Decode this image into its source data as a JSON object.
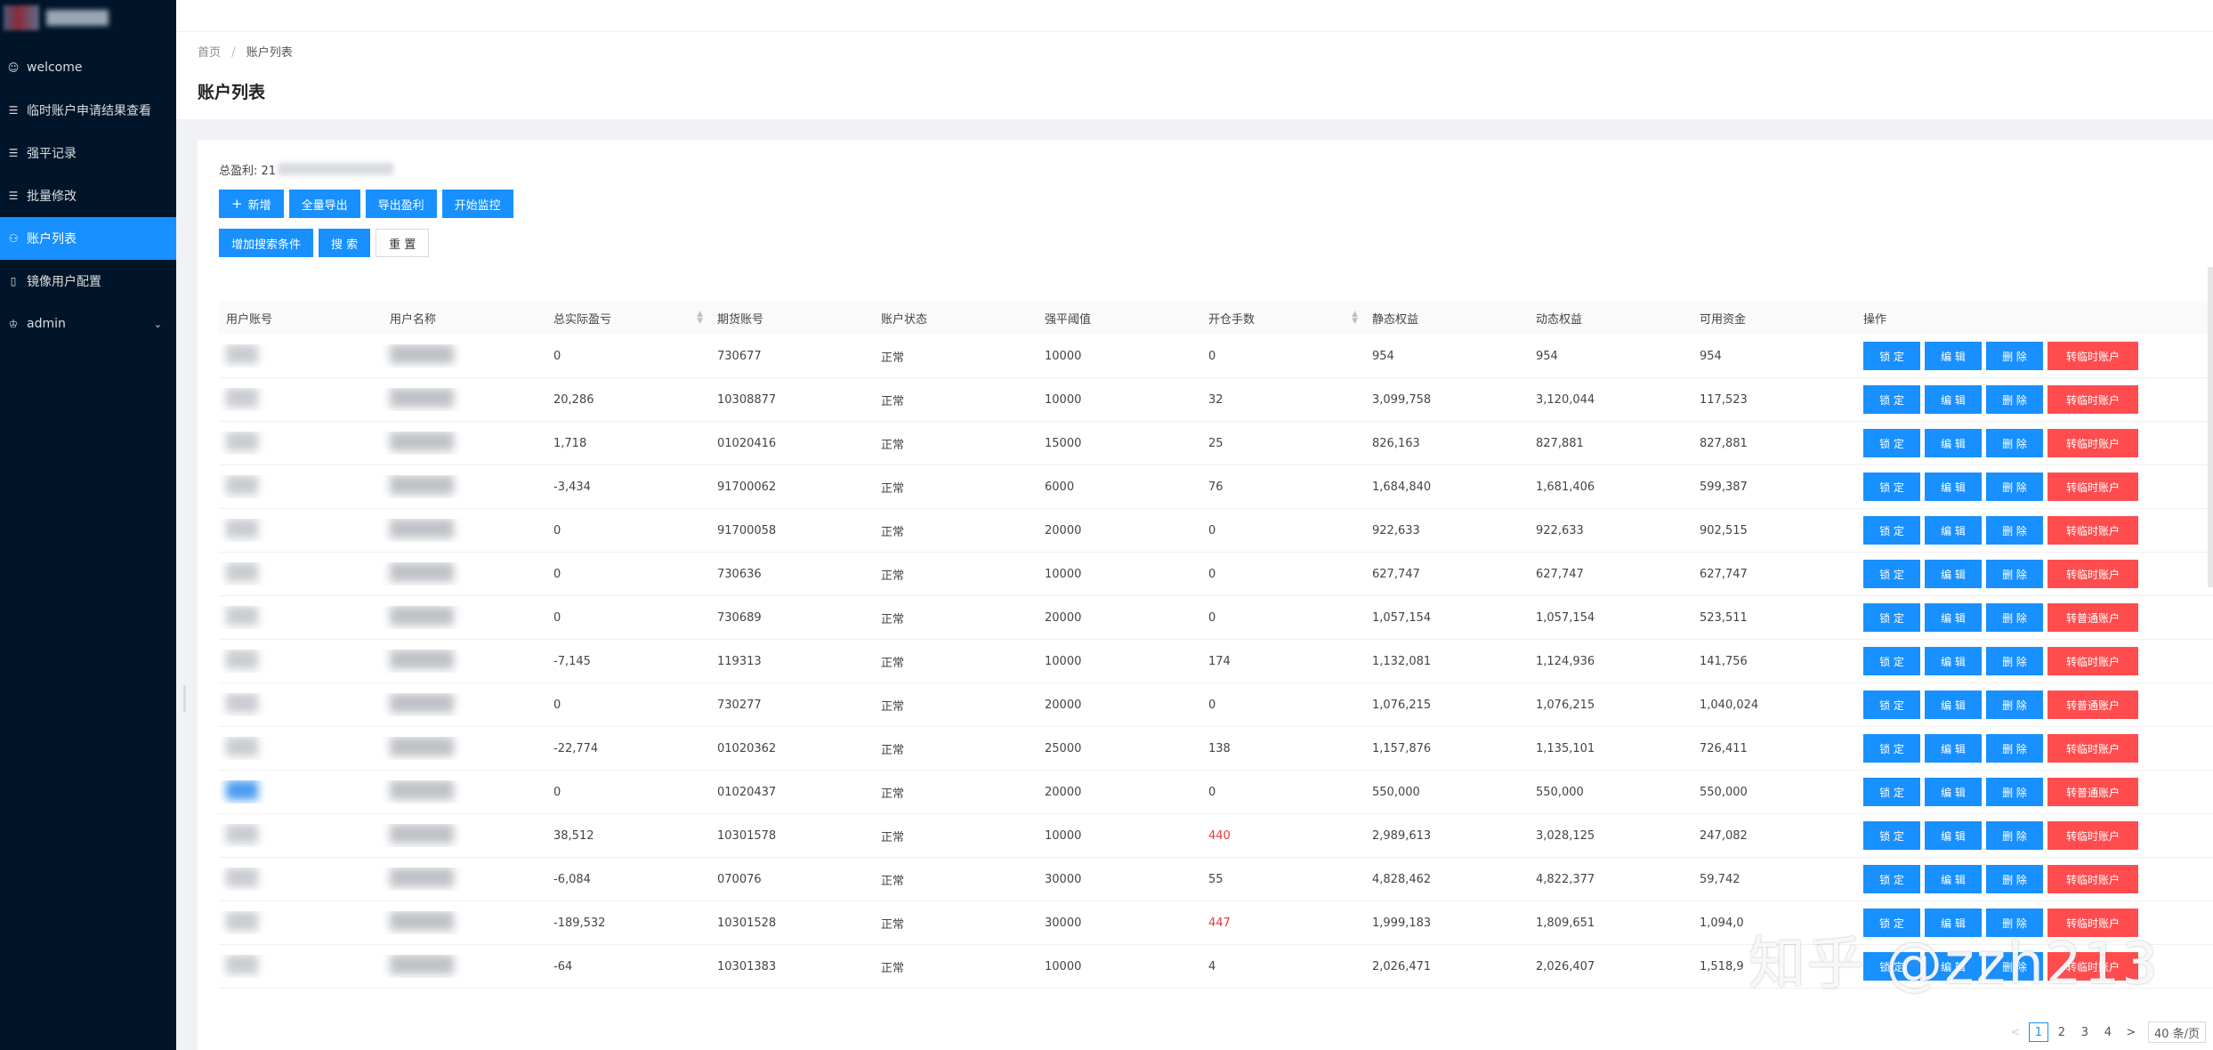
{
  "sidebar": {
    "items": [
      {
        "label": "welcome",
        "icon": "smile-icon"
      },
      {
        "label": "临时账户申请结果查看",
        "icon": "list-icon"
      },
      {
        "label": "强平记录",
        "icon": "list-icon"
      },
      {
        "label": "批量修改",
        "icon": "list-icon"
      },
      {
        "label": "账户列表",
        "icon": "user-icon",
        "active": true
      },
      {
        "label": "镜像用户配置",
        "icon": "file-icon"
      },
      {
        "label": "admin",
        "icon": "crown-icon",
        "expandable": true
      }
    ]
  },
  "breadcrumb": {
    "home": "首页",
    "separator": "/",
    "current": "账户列表"
  },
  "page_title": "账户列表",
  "summary": {
    "label": "总盈利: 21"
  },
  "toolbar": {
    "add": "新增",
    "export_all": "全量导出",
    "export_profit": "导出盈利",
    "start_monitor": "开始监控",
    "add_condition": "增加搜索条件",
    "search": "搜 索",
    "reset": "重 置"
  },
  "table": {
    "headers": [
      "用户账号",
      "用户名称",
      "总实际盈亏",
      "期货账号",
      "账户状态",
      "强平阈值",
      "开仓手数",
      "静态权益",
      "动态权益",
      "可用资金",
      "操作"
    ],
    "rows": [
      {
        "pnl": "0",
        "futures": "730677",
        "status": "正常",
        "threshold": "10000",
        "lots": "0",
        "static": "954",
        "dynamic": "954",
        "avail": "954",
        "convert": "转临时账户"
      },
      {
        "pnl": "20,286",
        "futures": "10308877",
        "status": "正常",
        "threshold": "10000",
        "lots": "32",
        "static": "3,099,758",
        "dynamic": "3,120,044",
        "avail": "117,523",
        "convert": "转临时账户"
      },
      {
        "pnl": "1,718",
        "futures": "01020416",
        "status": "正常",
        "threshold": "15000",
        "lots": "25",
        "static": "826,163",
        "dynamic": "827,881",
        "avail": "827,881",
        "convert": "转临时账户"
      },
      {
        "pnl": "-3,434",
        "futures": "91700062",
        "status": "正常",
        "threshold": "6000",
        "lots": "76",
        "static": "1,684,840",
        "dynamic": "1,681,406",
        "avail": "599,387",
        "convert": "转临时账户"
      },
      {
        "pnl": "0",
        "futures": "91700058",
        "status": "正常",
        "threshold": "20000",
        "lots": "0",
        "static": "922,633",
        "dynamic": "922,633",
        "avail": "902,515",
        "convert": "转临时账户"
      },
      {
        "pnl": "0",
        "futures": "730636",
        "status": "正常",
        "threshold": "10000",
        "lots": "0",
        "static": "627,747",
        "dynamic": "627,747",
        "avail": "627,747",
        "convert": "转临时账户"
      },
      {
        "pnl": "0",
        "futures": "730689",
        "status": "正常",
        "threshold": "20000",
        "lots": "0",
        "static": "1,057,154",
        "dynamic": "1,057,154",
        "avail": "523,511",
        "convert": "转普通账户"
      },
      {
        "pnl": "-7,145",
        "futures": "119313",
        "status": "正常",
        "threshold": "10000",
        "lots": "174",
        "static": "1,132,081",
        "dynamic": "1,124,936",
        "avail": "141,756",
        "convert": "转临时账户"
      },
      {
        "pnl": "0",
        "futures": "730277",
        "status": "正常",
        "threshold": "20000",
        "lots": "0",
        "static": "1,076,215",
        "dynamic": "1,076,215",
        "avail": "1,040,024",
        "convert": "转普通账户"
      },
      {
        "pnl": "-22,774",
        "futures": "01020362",
        "status": "正常",
        "threshold": "25000",
        "lots": "138",
        "static": "1,157,876",
        "dynamic": "1,135,101",
        "avail": "726,411",
        "convert": "转临时账户"
      },
      {
        "pnl": "0",
        "futures": "01020437",
        "status": "正常",
        "threshold": "20000",
        "lots": "0",
        "static": "550,000",
        "dynamic": "550,000",
        "avail": "550,000",
        "convert": "转普通账户"
      },
      {
        "pnl": "38,512",
        "futures": "10301578",
        "status": "正常",
        "threshold": "10000",
        "lots": "440",
        "lots_red": true,
        "static": "2,989,613",
        "dynamic": "3,028,125",
        "avail": "247,082",
        "convert": "转临时账户"
      },
      {
        "pnl": "-6,084",
        "futures": "070076",
        "status": "正常",
        "threshold": "30000",
        "lots": "55",
        "static": "4,828,462",
        "dynamic": "4,822,377",
        "avail": "59,742",
        "convert": "转临时账户"
      },
      {
        "pnl": "-189,532",
        "futures": "10301528",
        "status": "正常",
        "threshold": "30000",
        "lots": "447",
        "lots_red": true,
        "static": "1,999,183",
        "dynamic": "1,809,651",
        "avail": "1,094,0",
        "convert": "转临时账户"
      },
      {
        "pnl": "-64",
        "futures": "10301383",
        "status": "正常",
        "threshold": "10000",
        "lots": "4",
        "static": "2,026,471",
        "dynamic": "2,026,407",
        "avail": "1,518,9",
        "convert": "转临时账户"
      }
    ],
    "actions": {
      "lock": "锁 定",
      "edit": "编 辑",
      "delete": "删 除"
    }
  },
  "pagination": {
    "prev": "<",
    "pages": [
      "1",
      "2",
      "3",
      "4"
    ],
    "next": ">",
    "page_size": "40 条/页"
  },
  "watermark": "知乎 @zzh213",
  "colors": {
    "sidebar_bg": "#001529",
    "primary": "#1890ff",
    "danger": "#ff4d4f",
    "warn_text": "#e03c3c"
  }
}
